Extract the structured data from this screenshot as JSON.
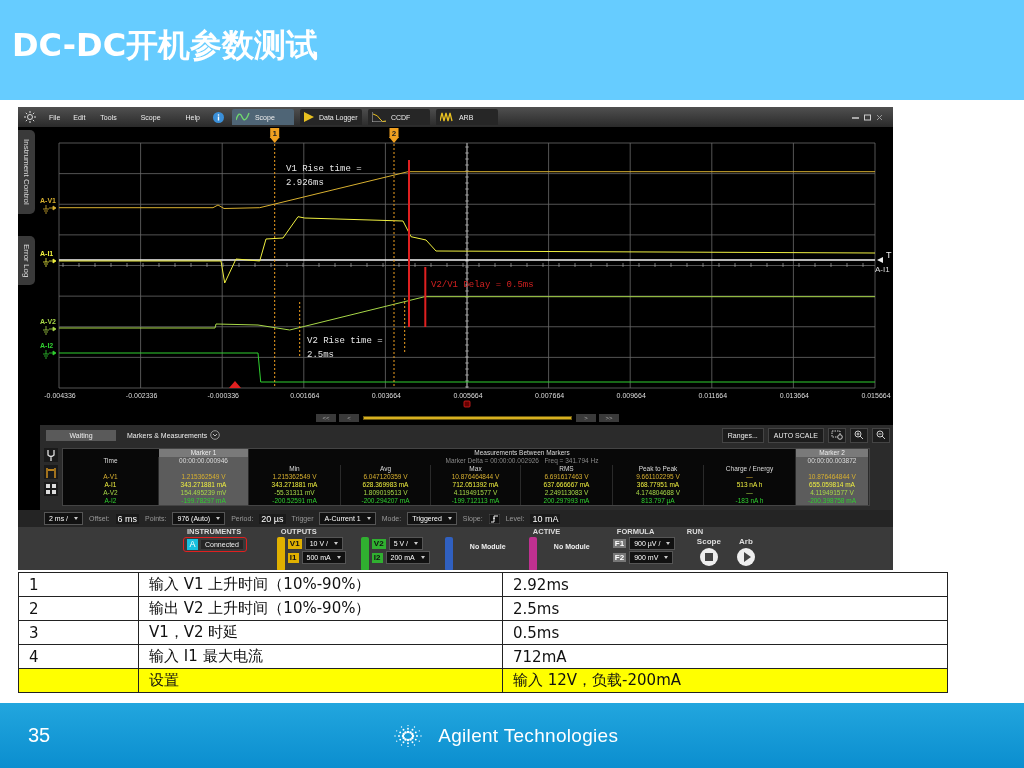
{
  "slide": {
    "title": "DC-DC开机参数测试",
    "page_number": "35",
    "logo_text": "Agilent Technologies"
  },
  "app": {
    "menu": [
      "File",
      "Edit",
      "Tools",
      "Scope",
      "Help"
    ],
    "tabs": [
      {
        "label": "Scope",
        "kind": "scope",
        "selected": true
      },
      {
        "label": "Data Logger",
        "kind": "logger",
        "selected": false
      },
      {
        "label": "CCDF",
        "kind": "ccdf",
        "selected": false
      },
      {
        "label": "ARB",
        "kind": "arb",
        "selected": false
      }
    ],
    "side_tabs": [
      "Instrument Control",
      "Error Log"
    ],
    "plot": {
      "markers": [
        "1",
        "2"
      ],
      "channels": [
        {
          "label": "A-V1",
          "color": "#d8b030"
        },
        {
          "label": "A-I1",
          "color": "#f0f040"
        },
        {
          "label": "A-V2",
          "color": "#a8d848"
        },
        {
          "label": "A-I2",
          "color": "#30d030"
        }
      ],
      "annotations": [
        {
          "lines": [
            "V1 Rise time =",
            "2.926ms"
          ],
          "kind": "rise"
        },
        {
          "lines": [
            "V2/V1 Delay = 0.5ms"
          ],
          "kind": "delay"
        },
        {
          "lines": [
            "V2 Rise time =",
            "2.5ms"
          ],
          "kind": "rise"
        }
      ],
      "x_ticks": [
        "-0.004336",
        "-0.002336",
        "-0.000336",
        "0.001664",
        "0.003664",
        "0.005664",
        "0.007664",
        "0.009664",
        "0.011664",
        "0.013664",
        "0.015664"
      ],
      "trigger": {
        "label": "T",
        "channel": "A-I1"
      }
    },
    "nav_buttons": [
      "<<",
      "<",
      ">",
      ">>"
    ],
    "measurements": {
      "status": "Waiting",
      "title": "Markers & Measurements",
      "buttons": [
        "Ranges...",
        "AUTO SCALE"
      ],
      "marker_1": {
        "label": "Marker 1",
        "time": "00:00:00.000946"
      },
      "between": {
        "label": "Measurements Between Markers",
        "info": "Marker Delta = 00:00:00.002926   Freq = 341.794 Hz"
      },
      "marker_2": {
        "label": "Marker 2",
        "time": "00:00:00.003872"
      },
      "time_label": "Time",
      "columns": [
        "Min",
        "Avg",
        "Max",
        "RMS",
        "Peak to Peak",
        "Charge / Energy"
      ],
      "rows": [
        {
          "channel": "A-V1",
          "marker_1": "1.215362549 V",
          "values": [
            "1.215362549 V",
            "6.047120359 V",
            "10.876464844 V",
            "6.691617463 V",
            "9.661102295 V",
            "—"
          ],
          "marker_2": "10.876464844 V"
        },
        {
          "channel": "A-I1",
          "marker_1": "343.271881 mA",
          "values": [
            "343.271881 mA",
            "628.369983 mA",
            "712.051392 mA",
            "637.666667 mA",
            "368.77951 mA",
            "513 nA h"
          ],
          "marker_2": "655.059814 mA"
        },
        {
          "channel": "A-V2",
          "marker_1": "154.495239 mV",
          "values": [
            "-55.31311 mV",
            "1.809019513 V",
            "4.119491577 V",
            "2.249113083 V",
            "4.174804688 V",
            "—"
          ],
          "marker_2": "4.119491577 V"
        },
        {
          "channel": "A-I2",
          "marker_1": "-199.78297 mA",
          "values": [
            "-200.52591 mA",
            "-200.294207 mA",
            "-199.712113 mA",
            "200.297993 mA",
            "813.797 µA",
            "-183 nA h"
          ],
          "marker_2": "-200.398758 mA"
        }
      ]
    },
    "timebase": [
      {
        "kind": "dropdown",
        "value": "2 ms /"
      },
      {
        "kind": "field",
        "label": "Offset:",
        "value": "6 ms"
      },
      {
        "kind": "dropdown",
        "label": "Points:",
        "value": "976 (Auto)"
      },
      {
        "kind": "field",
        "label": "Period:",
        "value": "20 µs"
      },
      {
        "kind": "dropdown",
        "label": "Trigger",
        "value": "A-Current 1"
      },
      {
        "kind": "dropdown",
        "label": "Mode:",
        "value": "Triggered"
      },
      {
        "kind": "slope",
        "label": "Slope:"
      },
      {
        "kind": "field",
        "label": "Level:",
        "value": "10 mA"
      }
    ],
    "sections": [
      {
        "kind": "instruments",
        "heading": "INSTRUMENTS",
        "badge": "A",
        "status": "Connected"
      },
      {
        "kind": "outputs",
        "heading": "OUTPUTS",
        "channels": [
          {
            "color": "#e0b000",
            "settings": [
              {
                "tag": "V1",
                "value": "10 V /"
              },
              {
                "tag": "I1",
                "value": "500 mA"
              }
            ]
          },
          {
            "color": "#30b030",
            "settings": [
              {
                "tag": "V2",
                "value": "5 V /"
              },
              {
                "tag": "I2",
                "value": "200 mA"
              }
            ]
          },
          {
            "color": "#3060c0",
            "module": "No Module"
          }
        ]
      },
      {
        "kind": "outputs",
        "heading": "ACTIVE",
        "channels": [
          {
            "color": "#c03090",
            "module": "No Module"
          }
        ]
      },
      {
        "kind": "formula",
        "heading": "FORMULA",
        "items": [
          {
            "tag": "F1",
            "value": "900 µV /"
          },
          {
            "tag": "F2",
            "value": "900 mV"
          }
        ]
      },
      {
        "kind": "run",
        "heading": "RUN",
        "buttons": [
          {
            "label": "Scope",
            "kind": "stop"
          },
          {
            "label": "Arb",
            "kind": "play"
          }
        ]
      }
    ]
  },
  "results": [
    {
      "index": "1",
      "item": "输入 V1 上升时间（10%-90%）",
      "value": "2.92ms",
      "highlighted": false
    },
    {
      "index": "2",
      "item": "输出 V2 上升时间（10%-90%）",
      "value": "2.5ms",
      "highlighted": false
    },
    {
      "index": "3",
      "item": "V1，V2 时延",
      "value": "0.5ms",
      "highlighted": false
    },
    {
      "index": "4",
      "item": "输入 I1 最大电流",
      "value": "712mA",
      "highlighted": false
    },
    {
      "item": "设置",
      "value": "输入 12V，负载-200mA",
      "highlighted": true
    }
  ]
}
